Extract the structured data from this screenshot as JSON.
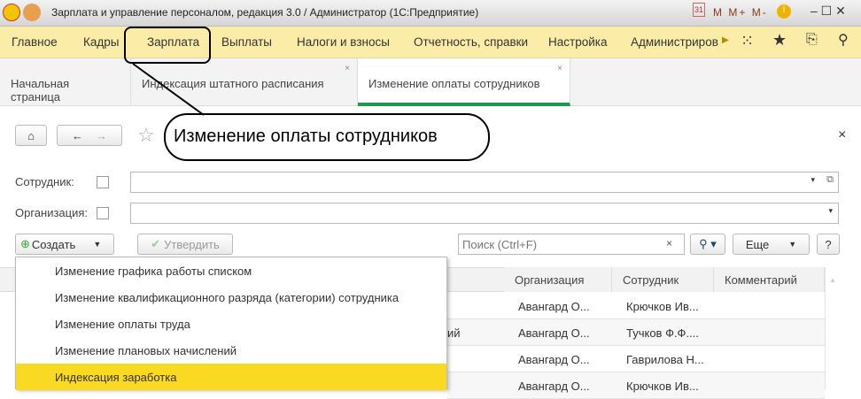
{
  "window": {
    "title": "Зарплата и управление персоналом, редакция 3.0 / Администратор  (1С:Предприятие)",
    "toolbar_icons": [
      "save-icon",
      "print-icon",
      "preview-icon",
      "favorites-add-icon",
      "bookmark-icon",
      "calculator-icon",
      "calendar-icon",
      "M",
      "M+",
      "M-",
      "info-icon",
      "minimize-icon",
      "maximize-icon"
    ],
    "calendar_day": "31"
  },
  "menu": {
    "items": [
      "Главное",
      "Кадры",
      "Зарплата",
      "Выплаты",
      "Налоги и взносы",
      "Отчетность, справки",
      "Настройка",
      "Администриров"
    ]
  },
  "tabs": [
    {
      "label": "Начальная страница"
    },
    {
      "label": "Индексация штатного расписания",
      "close": "×"
    },
    {
      "label": "Изменение оплаты сотрудников",
      "close": "×"
    }
  ],
  "page": {
    "title": "Изменение оплаты сотрудников",
    "close": "×"
  },
  "filters": {
    "employee_label": "Сотрудник:",
    "org_label": "Организация:"
  },
  "toolbar": {
    "create": "Создать",
    "approve": "Утвердить",
    "search_placeholder": "Поиск (Ctrl+F)",
    "clear": "×",
    "more": "Еще",
    "help": "?"
  },
  "create_menu": [
    "Изменение графика работы списком",
    "Изменение квалификационного разряда (категории) сотрудника",
    "Изменение оплаты труда",
    "Изменение плановых начислений",
    "Индексация заработка"
  ],
  "table": {
    "columns": [
      "Организация",
      "Сотрудник",
      "Комментарий"
    ],
    "rows": [
      {
        "fragment": "",
        "org": "Авангард О...",
        "emp": "Крючков Ив..."
      },
      {
        "fragment": "ий",
        "org": "Авангард О...",
        "emp": "Тучков Ф.Ф...."
      },
      {
        "fragment": "",
        "org": "Авангард О...",
        "emp": "Гаврилова Н..."
      },
      {
        "fragment": "",
        "org": "Авангард О...",
        "emp": "Крючков Ив..."
      }
    ]
  }
}
